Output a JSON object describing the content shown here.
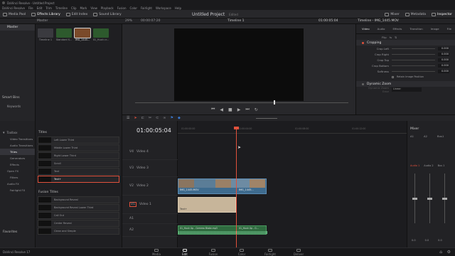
{
  "titlebar": {
    "title": "DaVinci Resolve - Untitled Project"
  },
  "menu": [
    "DaVinci Resolve",
    "File",
    "Edit",
    "Trim",
    "Timeline",
    "Clip",
    "Mark",
    "View",
    "Playback",
    "Fusion",
    "Color",
    "Fairlight",
    "Workspace",
    "Help"
  ],
  "toolbar": {
    "media_pool": "Media Pool",
    "effects_library": "Effects Library",
    "edit_index": "Edit Index",
    "sound_library": "Sound Library",
    "project_title": "Untitled Project",
    "edited": "Edited",
    "mixer": "Mixer",
    "metadata": "Metadata",
    "inspector": "Inspector"
  },
  "panelhdr": {
    "master": "Master",
    "zoom": "29%",
    "timecode_src": "00:00:07:20",
    "timeline_name": "Timeline 1",
    "timecode_rec": "01:00:05:04",
    "inspector_title": "Timeline - IMG_1445.MOV"
  },
  "mediapool": {
    "sidebar_master": "Master",
    "smart_bins": "Smart Bins",
    "keywords": "Keywords",
    "clips": [
      {
        "name": "Timeline 1",
        "color": "#3a3a3f"
      },
      {
        "name": "Standard S...",
        "color": "#2d5a2d"
      },
      {
        "name": "IMG_1445...",
        "color": "#7a4a2a"
      },
      {
        "name": "01_Hush cr...",
        "color": "#2d5a2d"
      }
    ]
  },
  "inspector": {
    "tabs": [
      "Video",
      "Audio",
      "Effects",
      "Transition",
      "Image",
      "File"
    ],
    "flip": "Flip",
    "section_cropping": "Cropping",
    "crop_rows": [
      {
        "label": "Crop Left",
        "value": "0.000"
      },
      {
        "label": "Crop Right",
        "value": "0.000"
      },
      {
        "label": "Crop Top",
        "value": "0.000"
      },
      {
        "label": "Crop Bottom",
        "value": "0.000"
      },
      {
        "label": "Softness",
        "value": "0.000"
      }
    ],
    "retain": "Retain Image Position",
    "section_dynamic_zoom": "Dynamic Zoom",
    "ease": "Linear",
    "dz_label": "Dynamic Zoom Ease"
  },
  "fx": {
    "toolbox": "Toolbox",
    "categories": [
      "Video Transitions",
      "Audio Transitions",
      "Titles",
      "Generators",
      "Effects",
      "Open FX",
      "Filters",
      "Audio FX",
      "Fairlight FX"
    ],
    "favorites": "Favorites",
    "titles_header": "Titles",
    "titles": [
      "Left Lower Third",
      "Middle Lower Third",
      "Right Lower Third",
      "Scroll",
      "Text",
      "Text+"
    ],
    "fusion_header": "Fusion Titles",
    "fusion_titles": [
      "Background Reveal",
      "Background Reveal Lower Third",
      "Call Out",
      "Center Reveal",
      "Clean and Simple"
    ]
  },
  "timeline": {
    "timecode": "01:00:05:04",
    "ruler": [
      "01:00:00:00",
      "01:00:04:00",
      "01:00:08:00",
      "01:00:12:00",
      "01:00:16:00"
    ],
    "tracks": [
      {
        "id": "V4",
        "name": "Video 4"
      },
      {
        "id": "V3",
        "name": "Video 3"
      },
      {
        "id": "V2",
        "name": "Video 2"
      },
      {
        "id": "V1",
        "name": "Video 1"
      },
      {
        "id": "A1",
        "name": ""
      },
      {
        "id": "A2",
        "name": ""
      }
    ],
    "clip_v2a": "IMG_1445.MOV",
    "clip_v2b": "IMG_1445...",
    "clip_v1": "Text+",
    "clip_a2a": "01_Hush Up - Gemma Blake.mp3",
    "clip_a2b": "01_Hush Up - G..."
  },
  "mixer": {
    "title": "Mixer",
    "channels": [
      "A1",
      "A2",
      "Bus1"
    ],
    "audio": [
      "Audio 1",
      "Audio 2",
      "Bus 1"
    ],
    "db": "0.0"
  },
  "pages": [
    "Media",
    "Edit",
    "Fusion",
    "Color",
    "Fairlight",
    "Deliver"
  ],
  "app_name": "DaVinci Resolve 17",
  "colors": {
    "accent": "#e0513c",
    "blue_clip": "#3e6b8e",
    "text_clip": "#c7b59a",
    "audio_clip": "#2f6b3f",
    "playhead": "#e0513c"
  }
}
